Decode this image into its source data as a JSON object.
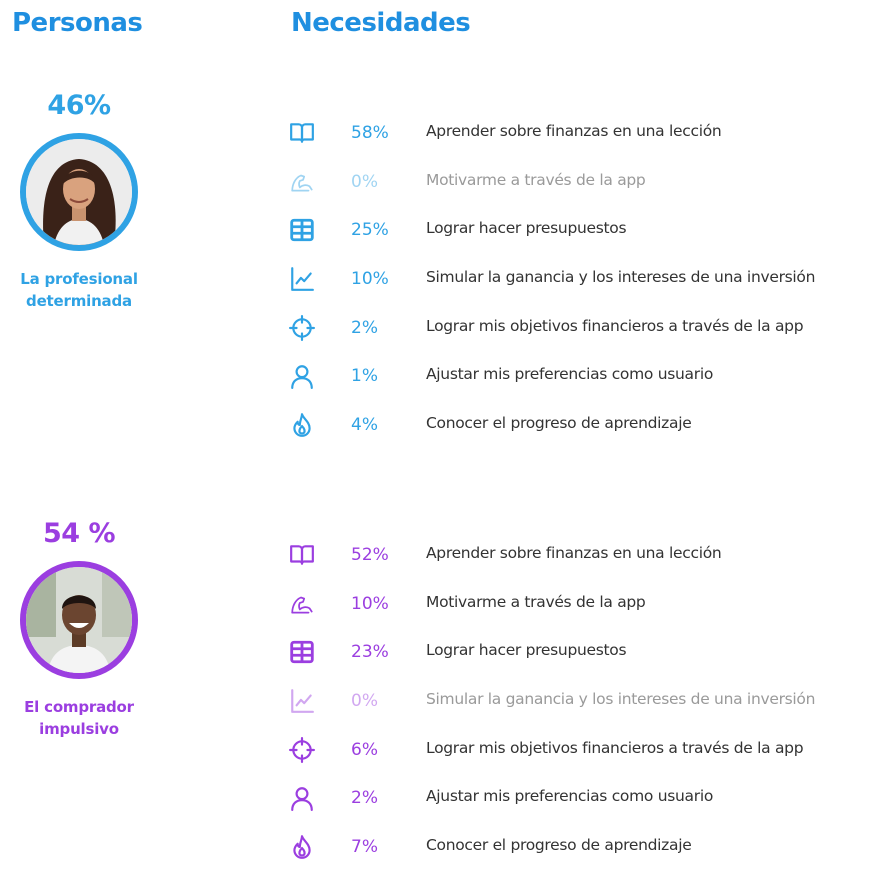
{
  "headings": {
    "personas": "Personas",
    "needs": "Necesidades"
  },
  "colors": {
    "heading": "#1f8fe0",
    "persona1": "#2fa2e4",
    "persona2": "#9b3ee0",
    "text": "#333333",
    "dim_text": "#9a9a9a"
  },
  "personas": [
    {
      "percent": "46%",
      "name_line1": "La profesional",
      "name_line2": "determinada",
      "needs": [
        {
          "icon": "book-icon",
          "percent": "58%",
          "label": "Aprender sobre finanzas en una lección"
        },
        {
          "icon": "flexed-arm-icon",
          "percent": "0%",
          "label": "Motivarme a través de la app"
        },
        {
          "icon": "stacked-cash-icon",
          "percent": "25%",
          "label": "Lograr hacer presupuestos"
        },
        {
          "icon": "line-chart-icon",
          "percent": "10%",
          "label": "Simular la ganancia y los intereses de una inversión"
        },
        {
          "icon": "crosshair-icon",
          "percent": "2%",
          "label": "Lograr mis objetivos financieros a través de la app"
        },
        {
          "icon": "user-icon",
          "percent": "1%",
          "label": "Ajustar mis preferencias como usuario"
        },
        {
          "icon": "flame-icon",
          "percent": "4%",
          "label": "Conocer el progreso de aprendizaje"
        }
      ]
    },
    {
      "percent": "54 %",
      "name_line1": "El comprador",
      "name_line2": "impulsivo",
      "needs": [
        {
          "icon": "book-icon",
          "percent": "52%",
          "label": "Aprender sobre finanzas en una lección"
        },
        {
          "icon": "flexed-arm-icon",
          "percent": "10%",
          "label": "Motivarme a través de la app"
        },
        {
          "icon": "stacked-cash-icon",
          "percent": "23%",
          "label": "Lograr hacer presupuestos"
        },
        {
          "icon": "line-chart-icon",
          "percent": "0%",
          "label": "Simular la ganancia y los intereses de una inversión"
        },
        {
          "icon": "crosshair-icon",
          "percent": "6%",
          "label": "Lograr mis objetivos financieros a través de la app"
        },
        {
          "icon": "user-icon",
          "percent": "2%",
          "label": "Ajustar mis preferencias como usuario"
        },
        {
          "icon": "flame-icon",
          "percent": "7%",
          "label": "Conocer el progreso de aprendizaje"
        }
      ]
    }
  ]
}
